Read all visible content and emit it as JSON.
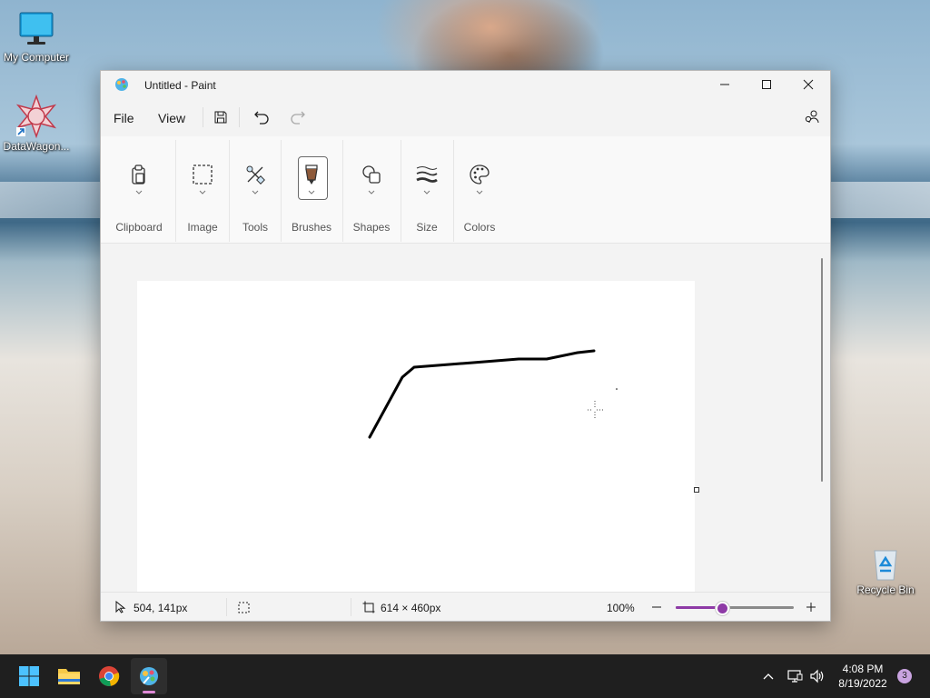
{
  "desktop": {
    "icons": [
      {
        "label": "My Computer"
      },
      {
        "label": "DataWagon..."
      },
      {
        "label": "Recycle Bin"
      }
    ]
  },
  "window": {
    "title": "Untitled - Paint",
    "menu": {
      "file": "File",
      "view": "View"
    },
    "ribbon": {
      "groups": [
        {
          "label": "Clipboard",
          "icon": "clipboard-icon"
        },
        {
          "label": "Image",
          "icon": "selection-icon"
        },
        {
          "label": "Tools",
          "icon": "tools-icon"
        },
        {
          "label": "Brushes",
          "icon": "brush-icon"
        },
        {
          "label": "Shapes",
          "icon": "shapes-icon"
        },
        {
          "label": "Size",
          "icon": "stroke-size-icon"
        },
        {
          "label": "Colors",
          "icon": "palette-icon"
        }
      ]
    },
    "status": {
      "cursor_position": "504, 141px",
      "canvas_size": "614 × 460px",
      "zoom": "100%",
      "zoom_level_fraction": 0.39
    },
    "colors": {
      "accent": "#8e3aa6",
      "stroke": "#000000"
    }
  },
  "taskbar": {
    "apps": [
      "start-icon",
      "file-explorer-icon",
      "chrome-icon",
      "paint-icon"
    ],
    "time": "4:08 PM",
    "date": "8/19/2022",
    "notification_count": "3"
  }
}
